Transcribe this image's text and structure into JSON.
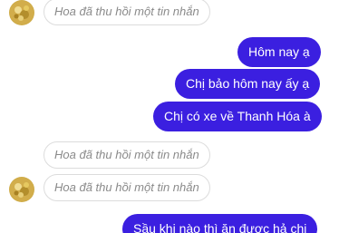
{
  "conversation": {
    "recalled_top": "Hoa đã thu hồi một tin nhắn",
    "sent_1": "Hôm nay ạ",
    "sent_2": "Chị bảo hôm nay ấy ạ",
    "sent_3": "Chị có xe về Thanh Hóa à",
    "recalled_2": "Hoa đã thu hồi một tin nhắn",
    "recalled_3": "Hoa đã thu hồi một tin nhắn",
    "sent_4": "Sầu khi nào thì ăn được hả chị"
  },
  "colors": {
    "sent_bubble": "#3b1fe0",
    "recalled_border": "#dcdcdc",
    "recalled_text": "#8a8a8a"
  }
}
